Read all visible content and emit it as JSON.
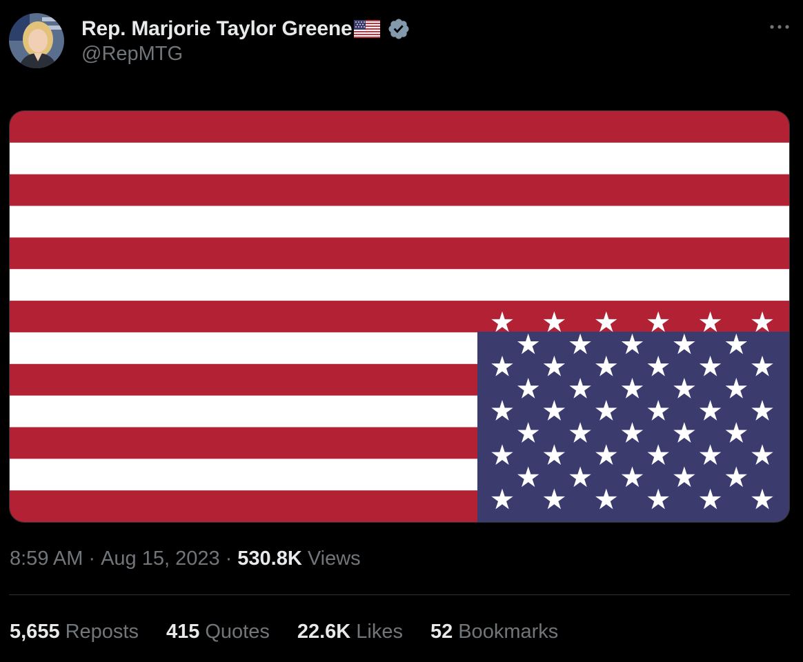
{
  "tweet": {
    "author": {
      "display_name": "Rep. Marjorie Taylor Greene",
      "handle": "@RepMTG",
      "name_emoji": "us-flag-emoji",
      "verified": true,
      "verified_badge_color": "#829aab"
    },
    "media": {
      "description_icon": "upside-down-american-flag",
      "stripe_red": "#b22234",
      "stripe_white": "#ffffff",
      "canton_blue": "#3c3b6e"
    },
    "meta": {
      "time": "8:59 AM",
      "separator": "·",
      "date": "Aug 15, 2023",
      "views_count": "530.8K",
      "views_label": "Views"
    },
    "stats": [
      {
        "count": "5,655",
        "label": "Reposts"
      },
      {
        "count": "415",
        "label": "Quotes"
      },
      {
        "count": "22.6K",
        "label": "Likes"
      },
      {
        "count": "52",
        "label": "Bookmarks"
      }
    ]
  },
  "colors": {
    "background": "#000000",
    "primary_text": "#e7e9ea",
    "secondary_text": "#71767b",
    "divider": "#2f3336"
  },
  "icons": {
    "more": "more-horizontal-icon",
    "verified": "verified-badge-icon"
  }
}
